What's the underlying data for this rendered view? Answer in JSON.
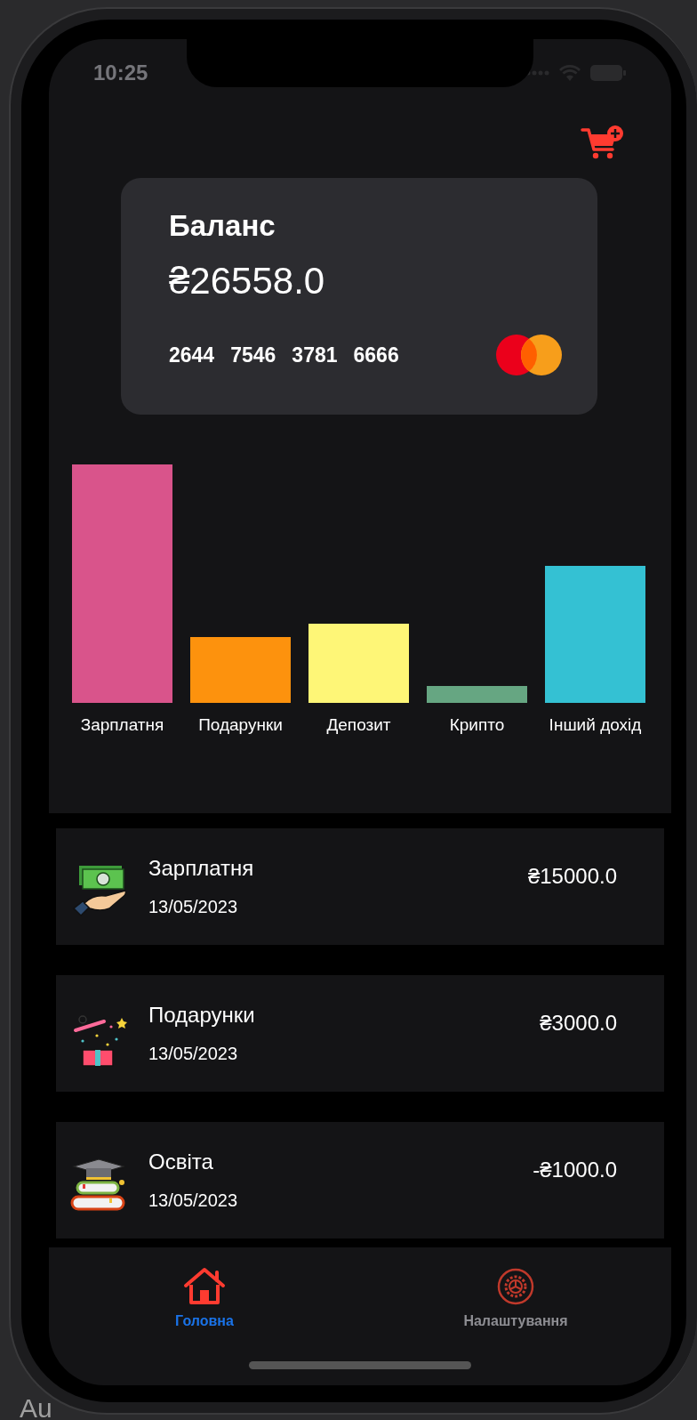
{
  "status_bar": {
    "time": "10:25"
  },
  "balance_card": {
    "title": "Баланс",
    "amount": "₴26558.0",
    "number_groups": [
      "2644",
      "7546",
      "3781",
      "6666"
    ]
  },
  "chart": {
    "categories": [
      {
        "label": "Зарплатня",
        "color": "#d9548b"
      },
      {
        "label": "Подарунки",
        "color": "#fd920d"
      },
      {
        "label": "Депозит",
        "color": "#fef677"
      },
      {
        "label": "Крипто",
        "color": "#66a682"
      },
      {
        "label": "Інший дохід",
        "color": "#34c1d3"
      }
    ]
  },
  "transactions": [
    {
      "kind": "salary",
      "title": "Зарплатня",
      "date": "13/05/2023",
      "amount": "₴15000.0"
    },
    {
      "kind": "gift",
      "title": "Подарунки",
      "date": "13/05/2023",
      "amount": "₴3000.0"
    },
    {
      "kind": "education",
      "title": "Освіта",
      "date": "13/05/2023",
      "amount": "-₴1000.0"
    }
  ],
  "tabs": [
    {
      "kind": "home",
      "label": "Головна",
      "selected": true
    },
    {
      "kind": "settings",
      "label": "Налаштування",
      "selected": false
    }
  ],
  "background_text": "Au"
}
